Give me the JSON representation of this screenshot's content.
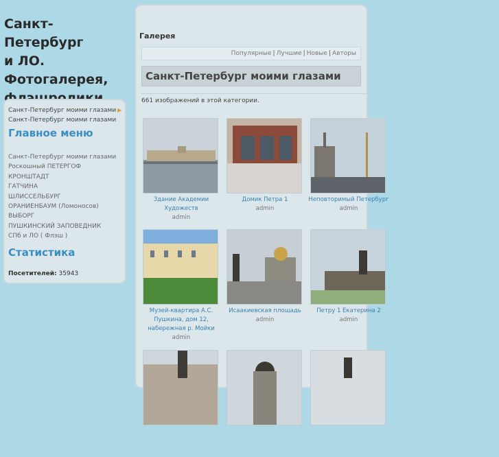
{
  "site": {
    "title_lines": [
      "Санкт-Петербург",
      "и ЛО.",
      "Фотогалерея,",
      "флэшролики."
    ]
  },
  "sidebar": {
    "top_links": [
      "Санкт-Петербург моими глазами",
      "Санкт-Петербург моими глазами"
    ],
    "main_menu_heading": "Главное меню",
    "menu_items": [
      "Санкт-Петербург моими глазами",
      "Роскошный ПЕТЕРГОФ",
      "КРОНШТАДТ",
      "ГАТЧИНА",
      "ШЛИССЕЛЬБУРГ",
      "ОРАНИЕНБАУМ (Ломоносов)",
      "ВЫБОРГ",
      "ПУШКИНСКИЙ ЗАПОВЕДНИК",
      "СПб и ЛО ( Флэш )"
    ],
    "stats_heading": "Статистика",
    "visitors_label": "Посетителей:",
    "visitors_value": "35943"
  },
  "gallery": {
    "header": "Галерея",
    "subnav": [
      "Популярные",
      "Лучшие",
      "Новые",
      "Авторы"
    ],
    "category_title": "Санкт-Петербург моими глазами",
    "count_text": "661 изображений в этой категории.",
    "items": [
      {
        "title": "Здание Академии Художеств",
        "author": "admin"
      },
      {
        "title": "Домик Петра 1",
        "author": "admin"
      },
      {
        "title": "Неповторимый Петербург",
        "author": "admin"
      },
      {
        "title": "Музей-квартира А.С. Пушкина, дом 12, набережная р. Мойки",
        "author": "admin"
      },
      {
        "title": "Исаакиевская площадь",
        "author": "admin"
      },
      {
        "title": "Петру 1 Екатерина 2",
        "author": "admin"
      },
      {
        "title": "",
        "author": ""
      },
      {
        "title": "",
        "author": ""
      },
      {
        "title": "",
        "author": ""
      }
    ]
  },
  "colors": {
    "background": "#add8e6",
    "panel": "#dce7ec",
    "accent": "#3a8ec0"
  }
}
